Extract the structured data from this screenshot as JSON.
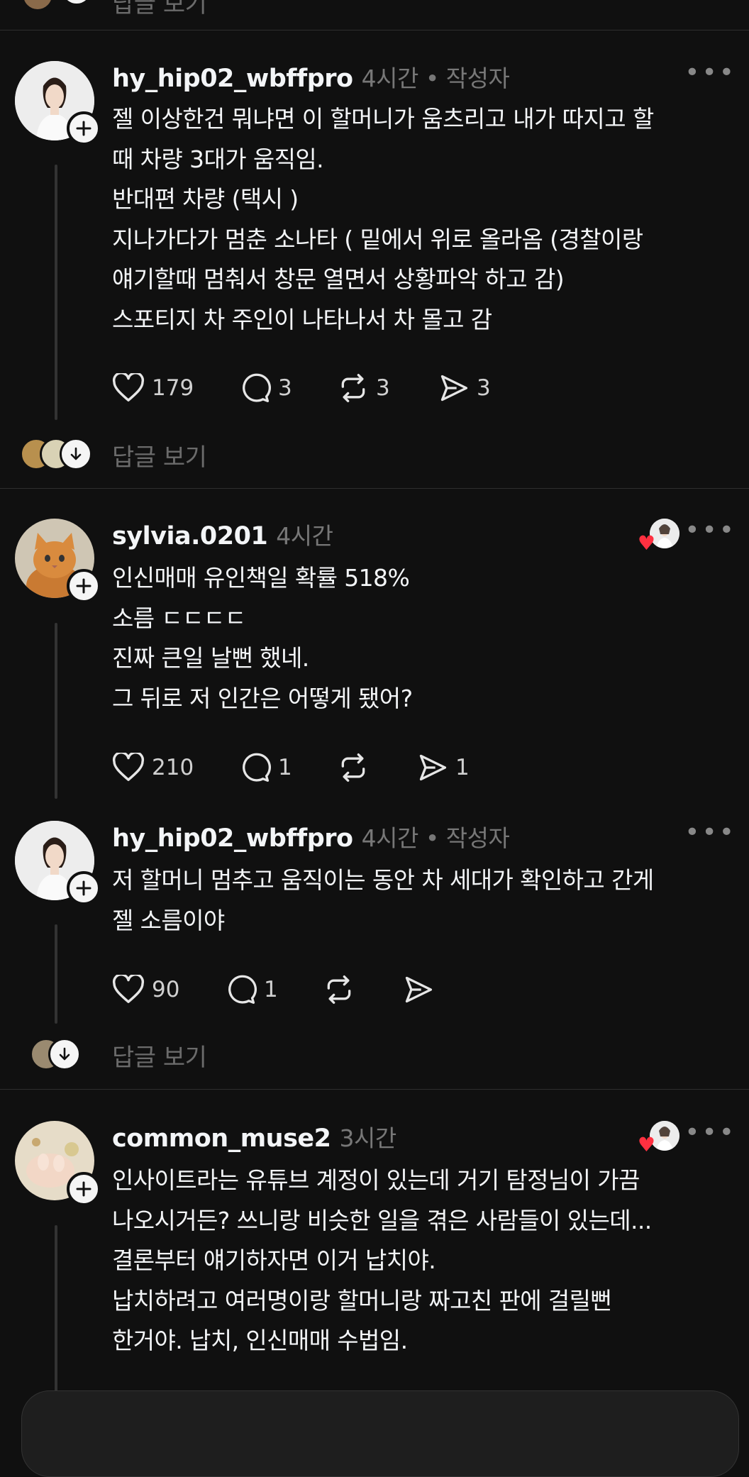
{
  "top_partial": {
    "replies_label": "답글 보기"
  },
  "posts": [
    {
      "username": "hy_hip02_wbffpro",
      "time": "4시간",
      "author_tag": "• 작성자",
      "lines": [
        "젤 이상한건 뭐냐면 이 할머니가 움츠리고 내가 따지고 할",
        "때 차량 3대가 움직임.",
        "반대편 차량 (택시 )",
        "지나가다가 멈춘 소나타 ( 밑에서 위로 올라옴 (경찰이랑",
        "얘기할때 멈춰서 창문 열면서 상황파악 하고 감)",
        "스포티지 차 주인이 나타나서 차 몰고 감"
      ],
      "likes": "179",
      "comments": "3",
      "reposts": "3",
      "shares": "3",
      "replies_label": "답글 보기"
    },
    {
      "username": "sylvia.0201",
      "time": "4시간",
      "lines": [
        "인신매매 유인책일 확률 518%",
        "소름 ㄷㄷㄷㄷ",
        "진짜 큰일 날뻔 했네.",
        "그 뒤로 저 인간은 어떻게 됐어?"
      ],
      "likes": "210",
      "comments": "1",
      "reposts": "",
      "shares": "1"
    },
    {
      "username": "hy_hip02_wbffpro",
      "time": "4시간",
      "author_tag": "• 작성자",
      "lines": [
        "저 할머니 멈추고 움직이는 동안 차 세대가 확인하고 간게",
        "젤 소름이야"
      ],
      "likes": "90",
      "comments": "1",
      "reposts": "",
      "shares": "",
      "replies_label": "답글 보기"
    },
    {
      "username": "common_muse2",
      "time": "3시간",
      "lines": [
        "인사이트라는 유튜브 계정이 있는데 거기 탐정님이 가끔",
        "나오시거든? 쓰니랑 비슷한 일을 겪은 사람들이 있는데...",
        "결론부터 얘기하자면 이거 납치야.",
        "납치하려고 여러명이랑 할머니랑 짜고친 판에 걸릴뻔",
        "한거야. 납치, 인신매매 수법임."
      ]
    }
  ],
  "colors": {
    "background": "#101010",
    "text": "#f3f5f7",
    "muted": "#777777",
    "heart": "#ff3040"
  },
  "icons": [
    "heart-icon",
    "comment-icon",
    "repost-icon",
    "share-icon",
    "plus-icon",
    "arrow-down-icon",
    "more-icon"
  ]
}
